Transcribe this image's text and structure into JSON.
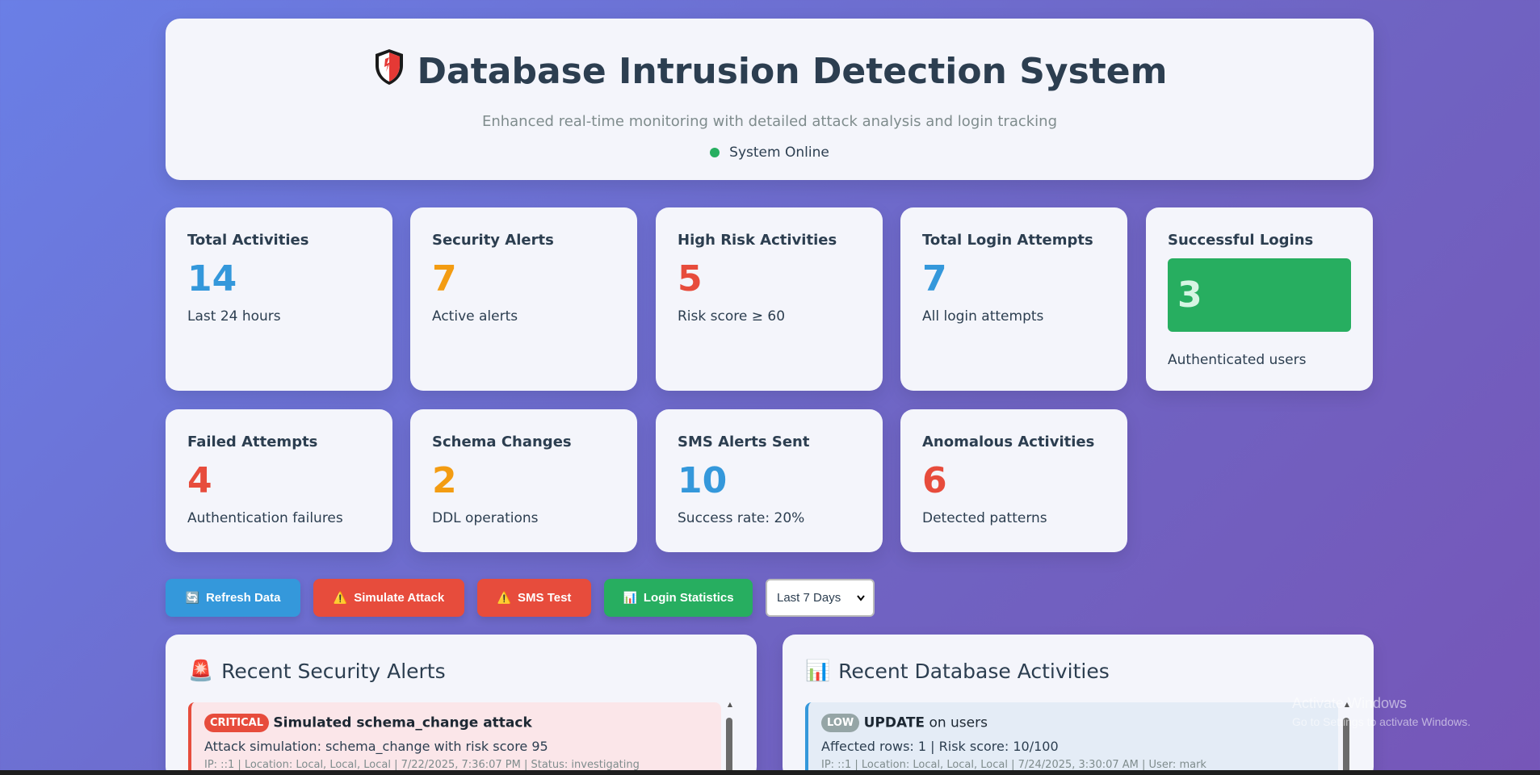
{
  "header": {
    "title": "Database Intrusion Detection System",
    "subtitle": "Enhanced real-time monitoring with detailed attack analysis and login tracking",
    "status": "System Online",
    "status_color": "#27ae60",
    "icon": "shield-icon"
  },
  "stats": [
    {
      "title": "Total Activities",
      "value": "14",
      "sub": "Last 24 hours",
      "color": "#3498db"
    },
    {
      "title": "Security Alerts",
      "value": "7",
      "sub": "Active alerts",
      "color": "#f39c12"
    },
    {
      "title": "High Risk Activities",
      "value": "5",
      "sub": "Risk score ≥ 60",
      "color": "#e74c3c"
    },
    {
      "title": "Total Login Attempts",
      "value": "7",
      "sub": "All login attempts",
      "color": "#3498db"
    },
    {
      "title": "Successful Logins",
      "value": "3",
      "sub": "Authenticated users",
      "color": "#27ae60"
    },
    {
      "title": "Failed Attempts",
      "value": "4",
      "sub": "Authentication failures",
      "color": "#e74c3c"
    },
    {
      "title": "Schema Changes",
      "value": "2",
      "sub": "DDL operations",
      "color": "#f39c12"
    },
    {
      "title": "SMS Alerts Sent",
      "value": "10",
      "sub": "Success rate: 20%",
      "color": "#3498db"
    },
    {
      "title": "Anomalous Activities",
      "value": "6",
      "sub": "Detected patterns",
      "color": "#e74c3c"
    }
  ],
  "toolbar": {
    "refresh_label": "Refresh Data",
    "simulate_label": "Simulate Attack",
    "sms_label": "SMS Test",
    "login_stats_label": "Login Statistics",
    "range_selected": "Last 7 Days"
  },
  "alerts_panel": {
    "title": "Recent Security Alerts",
    "icon": "siren-icon",
    "items": [
      {
        "badge": "CRITICAL",
        "title": "Simulated schema_change attack",
        "line": "Attack simulation: schema_change with risk score 95",
        "meta": "IP: ::1 | Location: Local, Local, Local | 7/22/2025, 7:36:07 PM | Status: investigating"
      }
    ]
  },
  "activities_panel": {
    "title": "Recent Database Activities",
    "icon": "bar-chart-icon",
    "items": [
      {
        "badge": "LOW",
        "operation": "UPDATE",
        "table_text": " on users",
        "line": "Affected rows: 1 | Risk score: 10/100",
        "meta": "IP: ::1 | Location: Local, Local, Local | 7/24/2025, 3:30:07 AM | User: mark"
      }
    ]
  },
  "watermark": {
    "line1": "Activate Windows",
    "line2": "Go to Settings to activate Windows."
  }
}
